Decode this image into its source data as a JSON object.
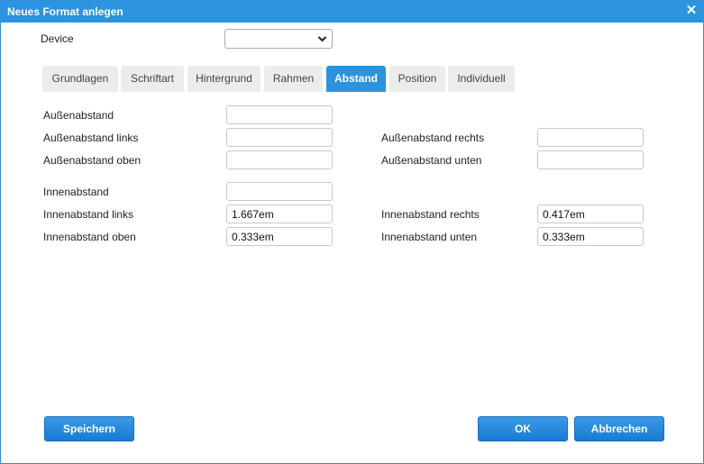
{
  "dialog": {
    "title": "Neues Format anlegen",
    "close_symbol": "✕"
  },
  "device": {
    "label": "Device",
    "selected_value": ""
  },
  "tabs": [
    {
      "label": "Grundlagen",
      "active": false
    },
    {
      "label": "Schriftart",
      "active": false
    },
    {
      "label": "Hintergrund",
      "active": false
    },
    {
      "label": "Rahmen",
      "active": false
    },
    {
      "label": "Abstand",
      "active": true
    },
    {
      "label": "Position",
      "active": false
    },
    {
      "label": "Individuell",
      "active": false
    }
  ],
  "margin": {
    "all": {
      "label": "Außenabstand",
      "value": ""
    },
    "left": {
      "label": "Außenabstand links",
      "value": ""
    },
    "right": {
      "label": "Außenabstand rechts",
      "value": ""
    },
    "top": {
      "label": "Außenabstand oben",
      "value": ""
    },
    "bottom": {
      "label": "Außenabstand unten",
      "value": ""
    }
  },
  "padding": {
    "all": {
      "label": "Innenabstand",
      "value": ""
    },
    "left": {
      "label": "Innenabstand links",
      "value": "1.667em"
    },
    "right": {
      "label": "Innenabstand rechts",
      "value": "0.417em"
    },
    "top": {
      "label": "Innenabstand oben",
      "value": "0.333em"
    },
    "bottom": {
      "label": "Innenabstand unten",
      "value": "0.333em"
    }
  },
  "buttons": {
    "save": "Speichern",
    "ok": "OK",
    "cancel": "Abbrechen"
  },
  "colors": {
    "accent": "#2b93e0",
    "tab_inactive": "#ececec"
  }
}
